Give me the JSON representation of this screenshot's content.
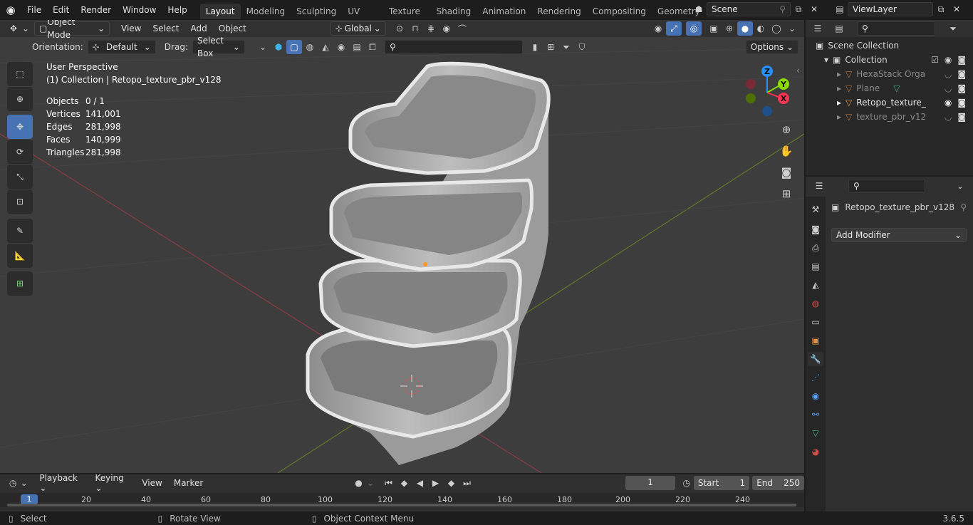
{
  "menu": [
    "File",
    "Edit",
    "Render",
    "Window",
    "Help"
  ],
  "workspaces": [
    "Layout",
    "Modeling",
    "Sculpting",
    "UV Editing",
    "Texture Paint",
    "Shading",
    "Animation",
    "Rendering",
    "Compositing",
    "Geometry Noc"
  ],
  "scene": {
    "name": "Scene"
  },
  "view_layer": {
    "name": "ViewLayer"
  },
  "viewport_header": {
    "mode": "Object Mode",
    "menus": [
      "View",
      "Select",
      "Add",
      "Object"
    ],
    "transform": "Global"
  },
  "tool_settings": {
    "orientation_label": "Orientation:",
    "orientation": "Default",
    "drag_label": "Drag:",
    "drag": "Select Box",
    "options": "Options"
  },
  "overlay": {
    "view_name": "User Perspective",
    "collection": "(1) Collection | Retopo_texture_pbr_v128",
    "stats": [
      {
        "label": "Objects",
        "value": "0 / 1"
      },
      {
        "label": "Vertices",
        "value": "141,001"
      },
      {
        "label": "Edges",
        "value": "281,998"
      },
      {
        "label": "Faces",
        "value": "140,999"
      },
      {
        "label": "Triangles",
        "value": "281,998"
      }
    ]
  },
  "gizmo": {
    "z": "Z",
    "y": "Y",
    "x": "X"
  },
  "outliner": {
    "root": "Scene Collection",
    "collection": "Collection",
    "items": [
      {
        "name": "HexaStack Orga",
        "dim": true
      },
      {
        "name": "Plane",
        "dim": true
      },
      {
        "name": "Retopo_texture_",
        "dim": false
      },
      {
        "name": "texture_pbr_v12",
        "dim": true
      }
    ]
  },
  "properties": {
    "object_name": "Retopo_texture_pbr_v128",
    "add_modifier": "Add Modifier"
  },
  "timeline": {
    "menus": [
      "Playback",
      "Keying",
      "View",
      "Marker"
    ],
    "current_frame": "1",
    "start_label": "Start",
    "start": "1",
    "end_label": "End",
    "end": "250",
    "ticks": [
      "1",
      "20",
      "40",
      "60",
      "80",
      "100",
      "120",
      "140",
      "160",
      "180",
      "200",
      "220",
      "240"
    ]
  },
  "statusbar": {
    "select": "Select",
    "rotate": "Rotate View",
    "context": "Object Context Menu",
    "version": "3.6.5"
  },
  "colors": {
    "accent": "#4772b3",
    "x_axis": "#ff3352",
    "y_axis": "#8bdc00",
    "z_axis": "#2890ff"
  }
}
